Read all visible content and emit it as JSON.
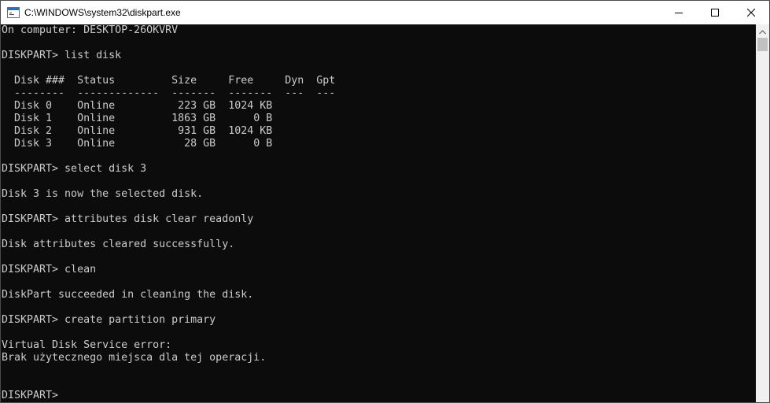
{
  "window": {
    "title": "C:\\WINDOWS\\system32\\diskpart.exe",
    "icons": {
      "app": "console-app-icon",
      "minimize": "minimize-icon",
      "maximize": "maximize-icon",
      "close": "close-icon"
    }
  },
  "console": {
    "lines": [
      "On computer: DESKTOP-26OKVRV",
      "",
      "DISKPART> list disk",
      "",
      "  Disk ###  Status         Size     Free     Dyn  Gpt",
      "  --------  -------------  -------  -------  ---  ---",
      "  Disk 0    Online          223 GB  1024 KB",
      "  Disk 1    Online         1863 GB      0 B",
      "  Disk 2    Online          931 GB  1024 KB",
      "  Disk 3    Online           28 GB      0 B",
      "",
      "DISKPART> select disk 3",
      "",
      "Disk 3 is now the selected disk.",
      "",
      "DISKPART> attributes disk clear readonly",
      "",
      "Disk attributes cleared successfully.",
      "",
      "DISKPART> clean",
      "",
      "DiskPart succeeded in cleaning the disk.",
      "",
      "DISKPART> create partition primary",
      "",
      "Virtual Disk Service error:",
      "Brak użytecznego miejsca dla tej operacji.",
      "",
      "",
      "DISKPART>"
    ]
  },
  "colors": {
    "console_bg": "#0c0c0c",
    "console_text": "#cccccc",
    "titlebar_bg": "#ffffff"
  }
}
